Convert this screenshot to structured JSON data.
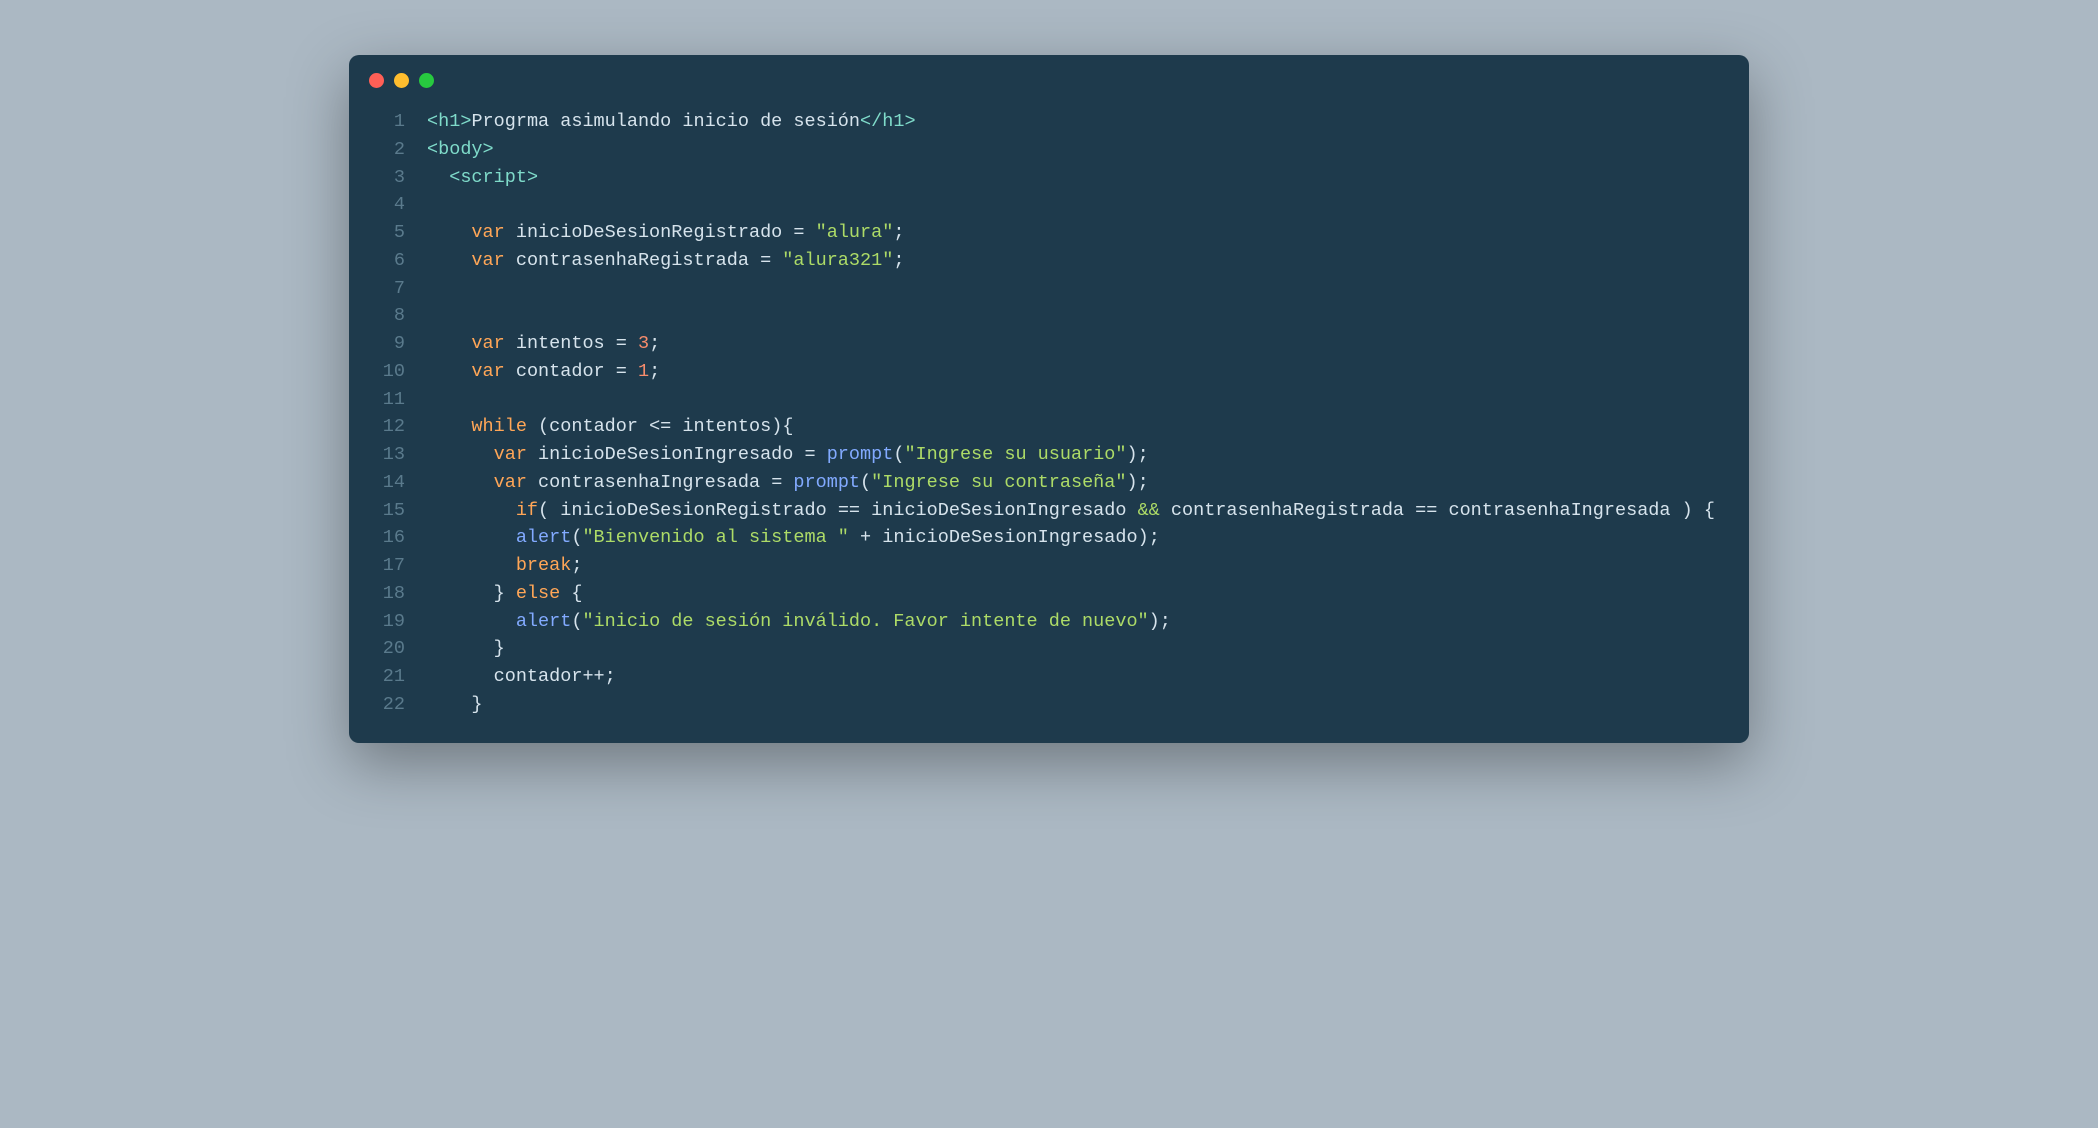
{
  "traffic_lights": {
    "red": "#ff5f56",
    "yellow": "#ffbd2e",
    "green": "#27c93f"
  },
  "lines": [
    {
      "num": "1",
      "tokens": [
        {
          "t": "punct",
          "v": "<"
        },
        {
          "t": "tag",
          "v": "h1"
        },
        {
          "t": "punct",
          "v": ">"
        },
        {
          "t": "text",
          "v": "Progrma asimulando inicio de sesión"
        },
        {
          "t": "punct",
          "v": "</"
        },
        {
          "t": "tag",
          "v": "h1"
        },
        {
          "t": "punct",
          "v": ">"
        }
      ]
    },
    {
      "num": "2",
      "tokens": [
        {
          "t": "punct",
          "v": "<"
        },
        {
          "t": "tag",
          "v": "body"
        },
        {
          "t": "punct",
          "v": ">"
        }
      ]
    },
    {
      "num": "3",
      "tokens": [
        {
          "t": "text",
          "v": "  "
        },
        {
          "t": "punct",
          "v": "<"
        },
        {
          "t": "tag",
          "v": "script"
        },
        {
          "t": "punct",
          "v": ">"
        }
      ]
    },
    {
      "num": "4",
      "tokens": []
    },
    {
      "num": "5",
      "tokens": [
        {
          "t": "text",
          "v": "    "
        },
        {
          "t": "keyword",
          "v": "var"
        },
        {
          "t": "text",
          "v": " inicioDeSesionRegistrado "
        },
        {
          "t": "op",
          "v": "="
        },
        {
          "t": "text",
          "v": " "
        },
        {
          "t": "string",
          "v": "\"alura\""
        },
        {
          "t": "op",
          "v": ";"
        }
      ]
    },
    {
      "num": "6",
      "tokens": [
        {
          "t": "text",
          "v": "    "
        },
        {
          "t": "keyword",
          "v": "var"
        },
        {
          "t": "text",
          "v": " contrasenhaRegistrada "
        },
        {
          "t": "op",
          "v": "="
        },
        {
          "t": "text",
          "v": " "
        },
        {
          "t": "string",
          "v": "\"alura321\""
        },
        {
          "t": "op",
          "v": ";"
        }
      ]
    },
    {
      "num": "7",
      "tokens": []
    },
    {
      "num": "8",
      "tokens": []
    },
    {
      "num": "9",
      "tokens": [
        {
          "t": "text",
          "v": "    "
        },
        {
          "t": "keyword",
          "v": "var"
        },
        {
          "t": "text",
          "v": " intentos "
        },
        {
          "t": "op",
          "v": "="
        },
        {
          "t": "text",
          "v": " "
        },
        {
          "t": "number",
          "v": "3"
        },
        {
          "t": "op",
          "v": ";"
        }
      ]
    },
    {
      "num": "10",
      "tokens": [
        {
          "t": "text",
          "v": "    "
        },
        {
          "t": "keyword",
          "v": "var"
        },
        {
          "t": "text",
          "v": " contador "
        },
        {
          "t": "op",
          "v": "="
        },
        {
          "t": "text",
          "v": " "
        },
        {
          "t": "number",
          "v": "1"
        },
        {
          "t": "op",
          "v": ";"
        }
      ]
    },
    {
      "num": "11",
      "tokens": []
    },
    {
      "num": "12",
      "tokens": [
        {
          "t": "text",
          "v": "    "
        },
        {
          "t": "keyword",
          "v": "while"
        },
        {
          "t": "text",
          "v": " "
        },
        {
          "t": "op",
          "v": "("
        },
        {
          "t": "text",
          "v": "contador "
        },
        {
          "t": "op",
          "v": "<="
        },
        {
          "t": "text",
          "v": " intentos"
        },
        {
          "t": "op",
          "v": ")"
        },
        {
          "t": "op",
          "v": "{"
        }
      ]
    },
    {
      "num": "13",
      "tokens": [
        {
          "t": "text",
          "v": "      "
        },
        {
          "t": "keyword",
          "v": "var"
        },
        {
          "t": "text",
          "v": " inicioDeSesionIngresado "
        },
        {
          "t": "op",
          "v": "="
        },
        {
          "t": "text",
          "v": " "
        },
        {
          "t": "func",
          "v": "prompt"
        },
        {
          "t": "op",
          "v": "("
        },
        {
          "t": "string",
          "v": "\"Ingrese su usuario\""
        },
        {
          "t": "op",
          "v": ")"
        },
        {
          "t": "op",
          "v": ";"
        }
      ]
    },
    {
      "num": "14",
      "tokens": [
        {
          "t": "text",
          "v": "      "
        },
        {
          "t": "keyword",
          "v": "var"
        },
        {
          "t": "text",
          "v": " contrasenhaIngresada "
        },
        {
          "t": "op",
          "v": "="
        },
        {
          "t": "text",
          "v": " "
        },
        {
          "t": "func",
          "v": "prompt"
        },
        {
          "t": "op",
          "v": "("
        },
        {
          "t": "string",
          "v": "\"Ingrese su contraseña\""
        },
        {
          "t": "op",
          "v": ")"
        },
        {
          "t": "op",
          "v": ";"
        }
      ]
    },
    {
      "num": "15",
      "tokens": [
        {
          "t": "text",
          "v": "        "
        },
        {
          "t": "keyword",
          "v": "if"
        },
        {
          "t": "op",
          "v": "("
        },
        {
          "t": "text",
          "v": " inicioDeSesionRegistrado "
        },
        {
          "t": "op",
          "v": "=="
        },
        {
          "t": "text",
          "v": " inicioDeSesionIngresado "
        },
        {
          "t": "amp",
          "v": "&&"
        },
        {
          "t": "text",
          "v": " contrasenhaRegistrada "
        },
        {
          "t": "op",
          "v": "=="
        },
        {
          "t": "text",
          "v": " contrasenhaIngresada "
        },
        {
          "t": "op",
          "v": ")"
        },
        {
          "t": "text",
          "v": " "
        },
        {
          "t": "op",
          "v": "{"
        }
      ]
    },
    {
      "num": "16",
      "tokens": [
        {
          "t": "text",
          "v": "        "
        },
        {
          "t": "func",
          "v": "alert"
        },
        {
          "t": "op",
          "v": "("
        },
        {
          "t": "string",
          "v": "\"Bienvenido al sistema \""
        },
        {
          "t": "text",
          "v": " "
        },
        {
          "t": "op",
          "v": "+"
        },
        {
          "t": "text",
          "v": " inicioDeSesionIngresado"
        },
        {
          "t": "op",
          "v": ")"
        },
        {
          "t": "op",
          "v": ";"
        }
      ]
    },
    {
      "num": "17",
      "tokens": [
        {
          "t": "text",
          "v": "        "
        },
        {
          "t": "keyword",
          "v": "break"
        },
        {
          "t": "op",
          "v": ";"
        }
      ]
    },
    {
      "num": "18",
      "tokens": [
        {
          "t": "text",
          "v": "      "
        },
        {
          "t": "op",
          "v": "}"
        },
        {
          "t": "text",
          "v": " "
        },
        {
          "t": "keyword",
          "v": "else"
        },
        {
          "t": "text",
          "v": " "
        },
        {
          "t": "op",
          "v": "{"
        }
      ]
    },
    {
      "num": "19",
      "tokens": [
        {
          "t": "text",
          "v": "        "
        },
        {
          "t": "func",
          "v": "alert"
        },
        {
          "t": "op",
          "v": "("
        },
        {
          "t": "string",
          "v": "\"inicio de sesión inválido. Favor intente de nuevo\""
        },
        {
          "t": "op",
          "v": ")"
        },
        {
          "t": "op",
          "v": ";"
        }
      ]
    },
    {
      "num": "20",
      "tokens": [
        {
          "t": "text",
          "v": "      "
        },
        {
          "t": "op",
          "v": "}"
        }
      ]
    },
    {
      "num": "21",
      "tokens": [
        {
          "t": "text",
          "v": "      contador"
        },
        {
          "t": "op",
          "v": "++"
        },
        {
          "t": "op",
          "v": ";"
        }
      ]
    },
    {
      "num": "22",
      "tokens": [
        {
          "t": "text",
          "v": "    "
        },
        {
          "t": "op",
          "v": "}"
        }
      ]
    }
  ]
}
